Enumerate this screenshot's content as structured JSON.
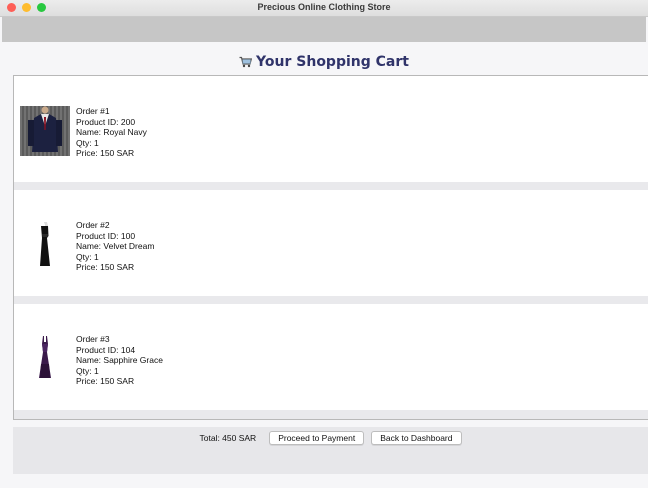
{
  "window": {
    "title": "Precious Online Clothing Store"
  },
  "cart": {
    "heading": "Your Shopping Cart",
    "orders": [
      {
        "order_label": "Order #1",
        "product_id": "Product ID: 200",
        "name": "Name: Royal Navy",
        "qty": "Qty: 1",
        "price": "Price: 150 SAR",
        "image": "navy-suit-image"
      },
      {
        "order_label": "Order #2",
        "product_id": "Product ID: 100",
        "name": "Name: Velvet Dream",
        "qty": "Qty: 1",
        "price": "Price: 150 SAR",
        "image": "black-dress-image"
      },
      {
        "order_label": "Order #3",
        "product_id": "Product ID: 104",
        "name": "Name: Sapphire Grace",
        "qty": "Qty: 1",
        "price": "Price: 150 SAR",
        "image": "purple-dress-image"
      }
    ]
  },
  "footer": {
    "total": "Total: 450 SAR",
    "proceed_label": "Proceed to Payment",
    "back_label": "Back to Dashboard"
  },
  "colors": {
    "heading": "#30346a",
    "close": "#fe5f57",
    "minimize": "#febc2e",
    "zoom": "#28c840"
  }
}
